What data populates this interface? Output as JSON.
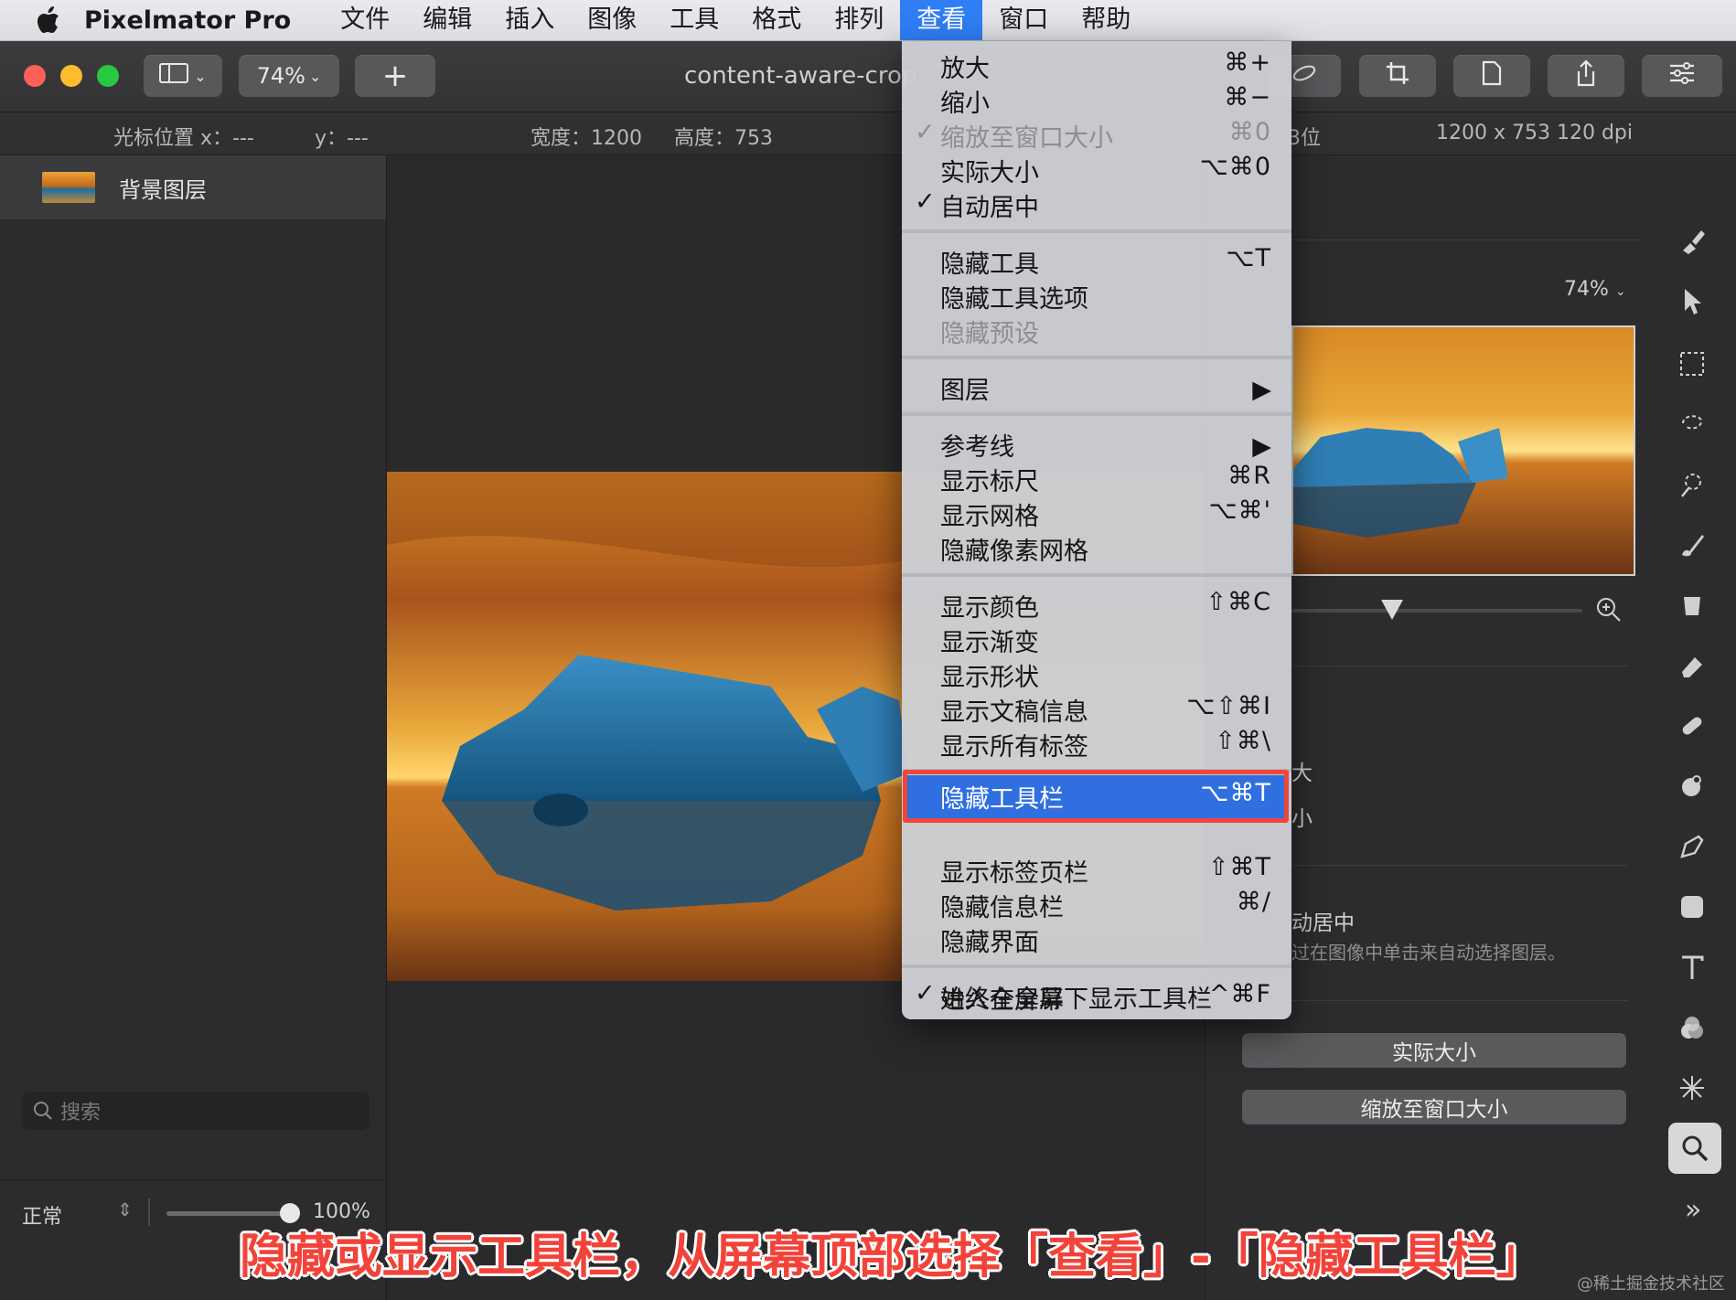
{
  "menubar": {
    "app": "Pixelmator Pro",
    "items": [
      "文件",
      "编辑",
      "插入",
      "图像",
      "工具",
      "格式",
      "排列",
      "查看",
      "窗口",
      "帮助"
    ],
    "active": "查看"
  },
  "toolbar": {
    "zoom": "74%",
    "add": "+",
    "doc_title": "content-aware-crop"
  },
  "infobar": {
    "cursor_x_label": "光标位置 x：---",
    "cursor_y_label": "y：---",
    "width_label": "宽度：1200",
    "height_label": "高度：753",
    "bits_fragment": "3位",
    "dims": "1200 x 753 120 dpi"
  },
  "layers": {
    "items": [
      {
        "name": "背景图层"
      }
    ],
    "blend_mode": "正常",
    "opacity": "100%",
    "opacity_fraction": 1.0,
    "search_placeholder": "搜索"
  },
  "right_panel": {
    "zoom_value": "74%",
    "zoom_in_fragment": "大",
    "zoom_out_fragment": "小",
    "auto_center": "动居中",
    "hint": "过在图像中单击来自动选择图层。",
    "actual_size_button": "实际大小",
    "fit_window_button": "缩放至窗口大小",
    "more": "»"
  },
  "view_menu": {
    "items": [
      {
        "label": "放大",
        "shortcut": "⌘+",
        "checked": false,
        "disabled": false
      },
      {
        "label": "缩小",
        "shortcut": "⌘−",
        "checked": false,
        "disabled": false
      },
      {
        "label": "缩放至窗口大小",
        "shortcut": "⌘0",
        "checked": true,
        "disabled": true
      },
      {
        "label": "实际大小",
        "shortcut": "⌥⌘0",
        "checked": false,
        "disabled": false
      },
      {
        "label": "自动居中",
        "shortcut": "",
        "checked": true,
        "disabled": false
      },
      {
        "label": "隐藏工具",
        "shortcut": "⌥T",
        "checked": false,
        "disabled": false
      },
      {
        "label": "隐藏工具选项",
        "shortcut": "",
        "checked": false,
        "disabled": false
      },
      {
        "label": "隐藏预设",
        "shortcut": "",
        "checked": false,
        "disabled": true
      },
      {
        "label": "图层",
        "shortcut": "",
        "submenu": true
      },
      {
        "label": "参考线",
        "shortcut": "",
        "submenu": true
      },
      {
        "label": "显示标尺",
        "shortcut": "⌘R"
      },
      {
        "label": "显示网格",
        "shortcut": "⌥⌘'"
      },
      {
        "label": "隐藏像素网格",
        "shortcut": ""
      },
      {
        "label": "显示颜色",
        "shortcut": "⇧⌘C"
      },
      {
        "label": "显示渐变",
        "shortcut": ""
      },
      {
        "label": "显示形状",
        "shortcut": ""
      },
      {
        "label": "显示文稿信息",
        "shortcut": "⌥⇧⌘I"
      },
      {
        "label": "显示所有标签",
        "shortcut": "⇧⌘\\"
      },
      {
        "label": "隐藏工具栏",
        "shortcut": "⌥⌘T",
        "highlighted": true
      },
      {
        "label": "显示标签页栏",
        "shortcut": "⇧⌘T"
      },
      {
        "label": "隐藏信息栏",
        "shortcut": "⌘/"
      },
      {
        "label": "隐藏界面",
        "shortcut": ""
      },
      {
        "label": "始终在全屏下显示工具栏",
        "shortcut": "",
        "checked": true
      },
      {
        "label": "进入全屏幕",
        "shortcut": "^⌘F"
      }
    ]
  },
  "caption": "隐藏或显示工具栏，从屏幕顶部选择「查看」-「隐藏工具栏」",
  "watermark": "@稀土掘金技术社区",
  "colors": {
    "accent": "#2f6fe0",
    "annotation_red": "#f0453c"
  }
}
